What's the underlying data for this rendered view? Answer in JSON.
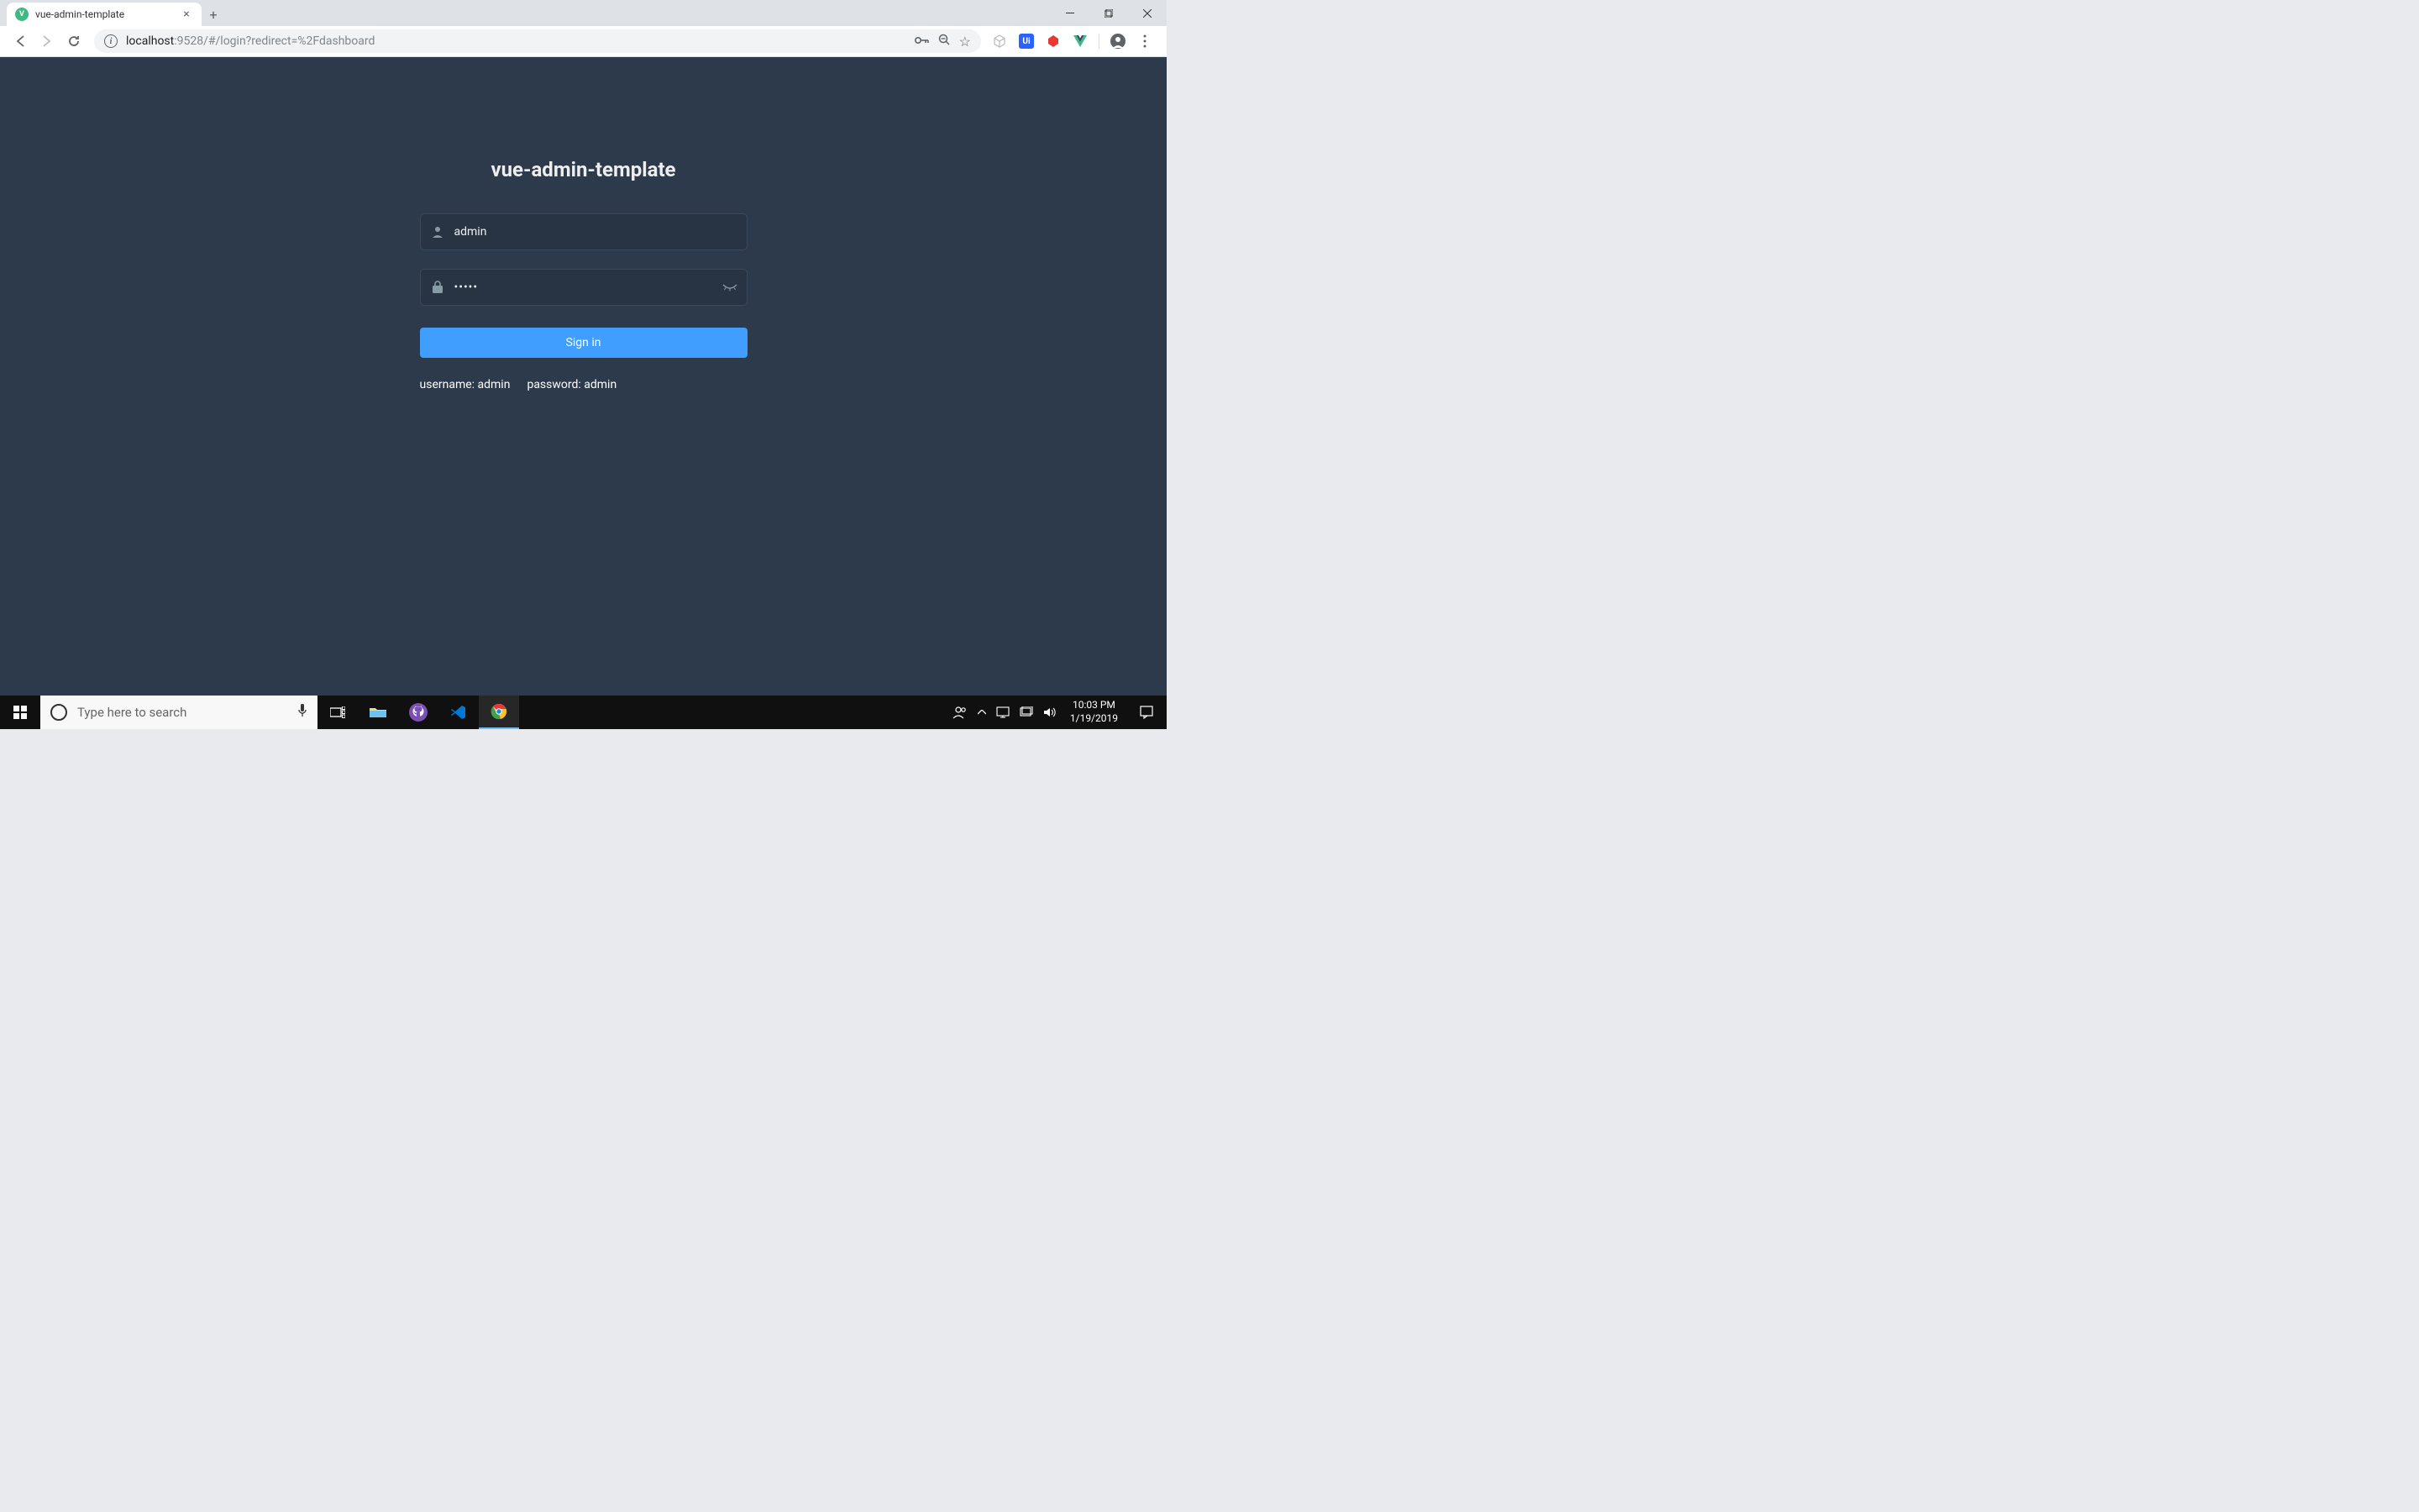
{
  "browser": {
    "tab_title": "vue-admin-template",
    "url_host": "localhost",
    "url_port": ":9528",
    "url_path": "/#/login?redirect=%2Fdashboard"
  },
  "login": {
    "title": "vue-admin-template",
    "username_value": "admin",
    "password_value": "•••••",
    "sign_in_label": "Sign in",
    "tip_username": "username: admin",
    "tip_password": "password: admin"
  },
  "taskbar": {
    "search_placeholder": "Type here to search",
    "time": "10:03 PM",
    "date": "1/19/2019"
  }
}
